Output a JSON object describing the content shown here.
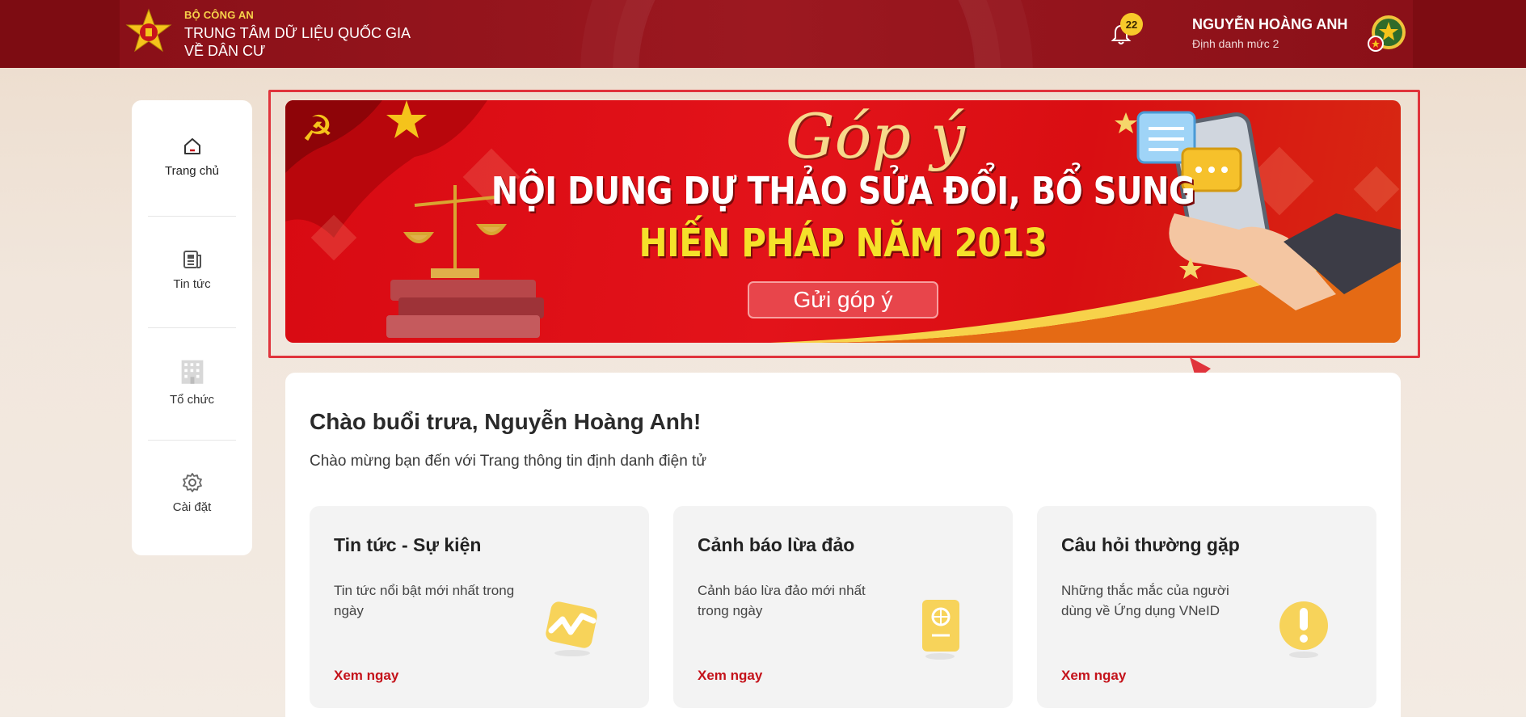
{
  "header": {
    "org_top": "BỘ CÔNG AN",
    "org_line1": "TRUNG TÂM DỮ LIỆU QUỐC GIA",
    "org_line2": "VỀ DÂN CƯ",
    "notification_count": "22",
    "user_name": "NGUYỄN HOÀNG ANH",
    "user_level": "Định danh mức 2",
    "icons": {
      "logo": "police-emblem",
      "bell": "bell-icon",
      "avatar": "emblem-avatar"
    }
  },
  "sidebar": {
    "items": [
      {
        "label": "Trang chủ",
        "icon": "home-icon",
        "active": true
      },
      {
        "label": "Tin tức",
        "icon": "news-icon",
        "active": false
      },
      {
        "label": "Tổ chức",
        "icon": "building-icon",
        "active": false
      },
      {
        "label": "Cài đặt",
        "icon": "gear-icon",
        "active": false
      }
    ]
  },
  "banner": {
    "script_title": "Góp ý",
    "line1": "NỘI DUNG DỰ THẢO SỬA ĐỔI, BỔ SUNG",
    "line2": "HIẾN PHÁP NĂM 2013",
    "button_label": "Gửi góp ý"
  },
  "main": {
    "greeting": "Chào buổi trưa, Nguyễn Hoàng Anh!",
    "subtitle": "Chào mừng bạn đến với Trang thông tin định danh điện tử",
    "cards": [
      {
        "title": "Tin tức - Sự kiện",
        "desc": "Tin tức nổi bật mới nhất trong ngày",
        "link": "Xem ngay",
        "icon": "trend-chart-icon"
      },
      {
        "title": "Cảnh báo lừa đảo",
        "desc": "Cảnh báo lừa đảo mới nhất trong ngày",
        "link": "Xem ngay",
        "icon": "passport-icon"
      },
      {
        "title": "Câu hỏi thường gặp",
        "desc": "Những thắc mắc của người dùng về Ứng dụng VNeID",
        "link": "Xem ngay",
        "icon": "exclamation-icon"
      }
    ]
  },
  "colors": {
    "header_red": "#8a1018",
    "accent_red": "#c4121a",
    "banner_red": "#e3131a",
    "badge_yellow": "#f8c92a",
    "annotation_red": "#e0343c"
  }
}
